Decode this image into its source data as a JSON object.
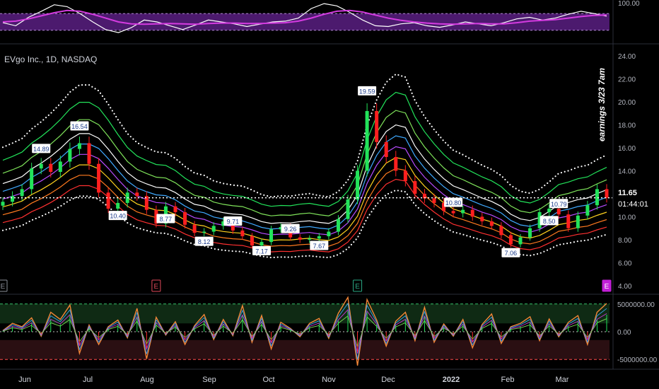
{
  "symbol_title": "EVgo Inc., 1D, NASDAQ",
  "annotation": "earnings 3/23 7am",
  "last_price": "11.65",
  "countdown": "01:44:01",
  "colors": {
    "up": "#22e35a",
    "down": "#ff1f1f",
    "dotted_band": "#ffffff",
    "rsi_band": "#8b2fc9",
    "rsi_line": "#ffffff",
    "rsi_signal": "#d43be0",
    "earnings_marker_past": "#8a8f99",
    "earnings_marker_upcoming": "#c21fd6",
    "ribbon": [
      "#ff3030",
      "#ff7a1f",
      "#ffd21f",
      "#b84cff",
      "#3fa9ff",
      "#ffffff",
      "#7fe35a",
      "#22e35a"
    ]
  },
  "chart_data": [
    {
      "type": "line",
      "name": "RSI panel",
      "y_tick_labels": [
        "100.00"
      ],
      "ylim": [
        0,
        100
      ],
      "series": [
        {
          "values": [
            48,
            40,
            62,
            78,
            95,
            90,
            72,
            50,
            30,
            22,
            35,
            55,
            50,
            40,
            30,
            42,
            55,
            50,
            45,
            38,
            44,
            50,
            52,
            60,
            85,
            98,
            92,
            75,
            55,
            40,
            38,
            45,
            48,
            40,
            36,
            42,
            50,
            45,
            40,
            48,
            58,
            62,
            55,
            60,
            70,
            78,
            72,
            65
          ]
        },
        {
          "values": [
            50,
            52,
            58,
            66,
            74,
            80,
            78,
            70,
            60,
            50,
            45,
            44,
            45,
            46,
            45,
            44,
            46,
            47,
            47,
            46,
            46,
            47,
            48,
            52,
            60,
            70,
            78,
            80,
            76,
            68,
            60,
            54,
            50,
            47,
            45,
            44,
            45,
            46,
            45,
            45,
            48,
            52,
            54,
            56,
            60,
            64,
            67,
            68
          ]
        }
      ]
    },
    {
      "type": "line",
      "name": "Price panel",
      "x_tick_labels": [
        "Jun",
        "Jul",
        "Aug",
        "Sep",
        "Oct",
        "Nov",
        "Dec",
        "2022",
        "Feb",
        "Mar"
      ],
      "y_tick_labels": [
        "24.00",
        "22.00",
        "20.00",
        "18.00",
        "16.00",
        "14.00",
        "12.00",
        "10.00",
        "8.00",
        "6.00",
        "4.00"
      ],
      "ylim": [
        3.5,
        24.8
      ],
      "marked_prices": [
        "14.89",
        "16.54",
        "10.40",
        "8.77",
        "8.12",
        "9.71",
        "7.17",
        "9.26",
        "7.67",
        "19.59",
        "10.80",
        "7.06",
        "10.79",
        "8.50"
      ],
      "last_price": 11.65,
      "series": [
        {
          "name": "close",
          "values": [
            11.3,
            11.8,
            12.4,
            14.2,
            14.6,
            13.9,
            14.8,
            15.9,
            16.4,
            14.6,
            12.1,
            10.7,
            11.2,
            12.1,
            11.8,
            10.6,
            9.4,
            10.9,
            10.4,
            9.3,
            8.6,
            8.7,
            9.2,
            9.6,
            8.8,
            8.3,
            7.5,
            7.8,
            8.9,
            9.1,
            8.2,
            8.0,
            8.1,
            8.3,
            8.7,
            9.8,
            11.5,
            14.0,
            19.2,
            16.5,
            15.2,
            14.0,
            13.1,
            12.0,
            11.6,
            11.2,
            10.5,
            10.3,
            10.6,
            10.0,
            9.6,
            9.2,
            8.4,
            7.6,
            8.2,
            9.0,
            10.4,
            10.7,
            10.2,
            9.0,
            10.1,
            11.0,
            12.4,
            11.65
          ]
        }
      ]
    },
    {
      "type": "bar",
      "name": "Volume oscillator panel",
      "y_tick_labels": [
        "5000000.00",
        "0.00",
        "-5000000.00"
      ],
      "ylim": [
        -6500000,
        6500000
      ],
      "series": [
        {
          "values": [
            200000,
            1500000,
            900000,
            2500000,
            -800000,
            3500000,
            2200000,
            4800000,
            -3900000,
            1200000,
            -2300000,
            900000,
            2100000,
            -1100000,
            4200000,
            -4900000,
            2600000,
            -600000,
            1800000,
            -2300000,
            1100000,
            3100000,
            -1400000,
            2200000,
            -700000,
            4700000,
            -1900000,
            2900000,
            -3100000,
            1700000,
            600000,
            -900000,
            1500000,
            2400000,
            -1200000,
            3300000,
            6200000,
            -6100000,
            5800000,
            2100000,
            -2600000,
            1900000,
            3500000,
            -1600000,
            4400000,
            -1900000,
            1400000,
            -800000,
            2200000,
            -2900000,
            1300000,
            3200000,
            -2100000,
            900000,
            1500000,
            2700000,
            -1600000,
            2300000,
            -900000,
            1700000,
            2900000,
            -2300000,
            3500000,
            5100000
          ]
        }
      ]
    }
  ],
  "earnings_markers": [
    "E",
    "E",
    "E",
    "E"
  ]
}
